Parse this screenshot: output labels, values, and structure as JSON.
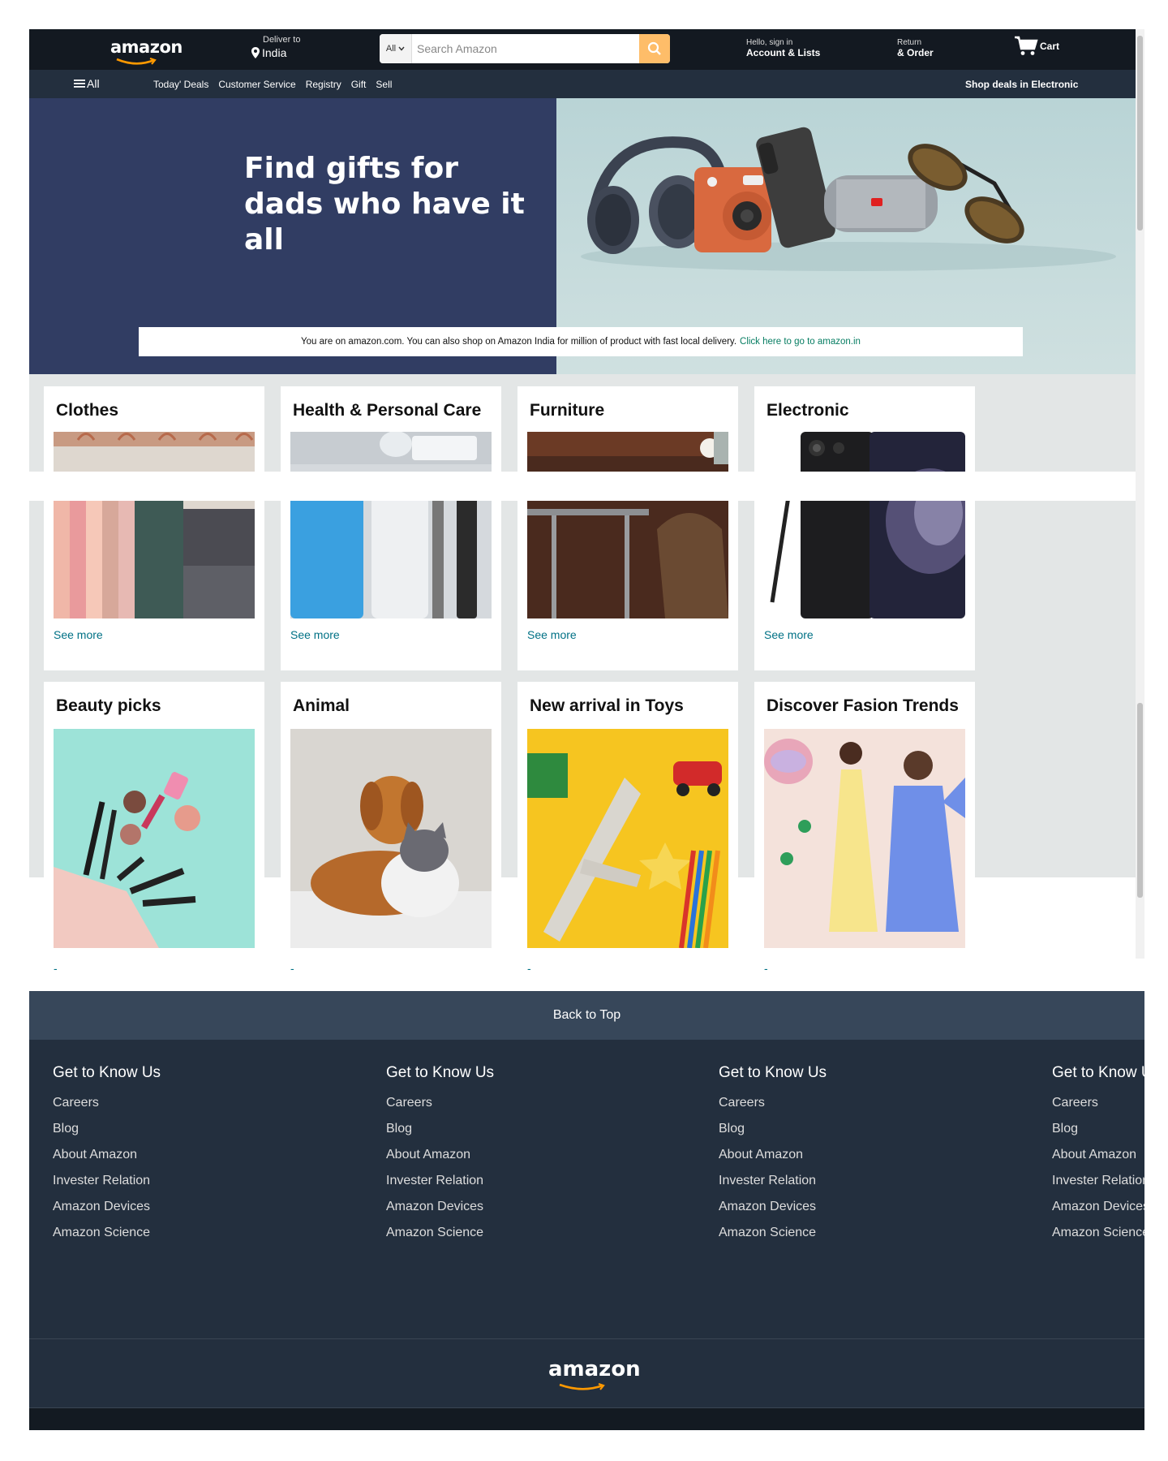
{
  "nav": {
    "logo": "amazon",
    "deliver_small": "Deliver to",
    "deliver_location": "India",
    "search_category": "All",
    "search_placeholder": "Search Amazon",
    "account_small": "Hello, sign in",
    "account_big": "Account & Lists",
    "returns_small": "Return",
    "returns_big": "& Order",
    "cart_label": "Cart"
  },
  "subnav": {
    "all_label": "All",
    "links": [
      "Today' Deals",
      "Customer Service",
      "Registry",
      "Gift",
      "Sell"
    ],
    "deals_right": "Shop deals in Electronic"
  },
  "hero": {
    "title_line1": "Find gifts for",
    "title_line2": "dads who have it all",
    "notice_text": "You are on amazon.com. You can also shop on Amazon India for million of product with fast local delivery.",
    "notice_link": "Click here to go to amazon.in"
  },
  "cards": [
    {
      "title": "Clothes",
      "see_more": "See more"
    },
    {
      "title": "Health & Personal Care",
      "see_more": "See more"
    },
    {
      "title": "Furniture",
      "see_more": "See more"
    },
    {
      "title": "Electronic",
      "see_more": "See more"
    },
    {
      "title": "Beauty picks"
    },
    {
      "title": "Animal"
    },
    {
      "title": "New arrival in Toys"
    },
    {
      "title": "Discover Fasion Trends"
    }
  ],
  "footer": {
    "back_to_top": "Back to Top",
    "columns": [
      {
        "heading": "Get to Know Us",
        "links": [
          "Careers",
          "Blog",
          "About Amazon",
          "Invester Relation",
          "Amazon Devices",
          "Amazon Science"
        ]
      },
      {
        "heading": "Get to Know Us",
        "links": [
          "Careers",
          "Blog",
          "About Amazon",
          "Invester Relation",
          "Amazon Devices",
          "Amazon Science"
        ]
      },
      {
        "heading": "Get to Know Us",
        "links": [
          "Careers",
          "Blog",
          "About Amazon",
          "Invester Relation",
          "Amazon Devices",
          "Amazon Science"
        ]
      },
      {
        "heading": "Get to Know Us",
        "links": [
          "Careers",
          "Blog",
          "About Amazon",
          "Invester Relation",
          "Amazon Devices",
          "Amazon Science"
        ]
      }
    ],
    "logo": "amazon"
  },
  "colors": {
    "nav_dark": "#131921",
    "nav_sub": "#232f3e",
    "search_button": "#febd69",
    "hero_left": "#313d63",
    "link": "#007185",
    "notice_link": "#067d62",
    "back_to_top": "#37475a"
  }
}
